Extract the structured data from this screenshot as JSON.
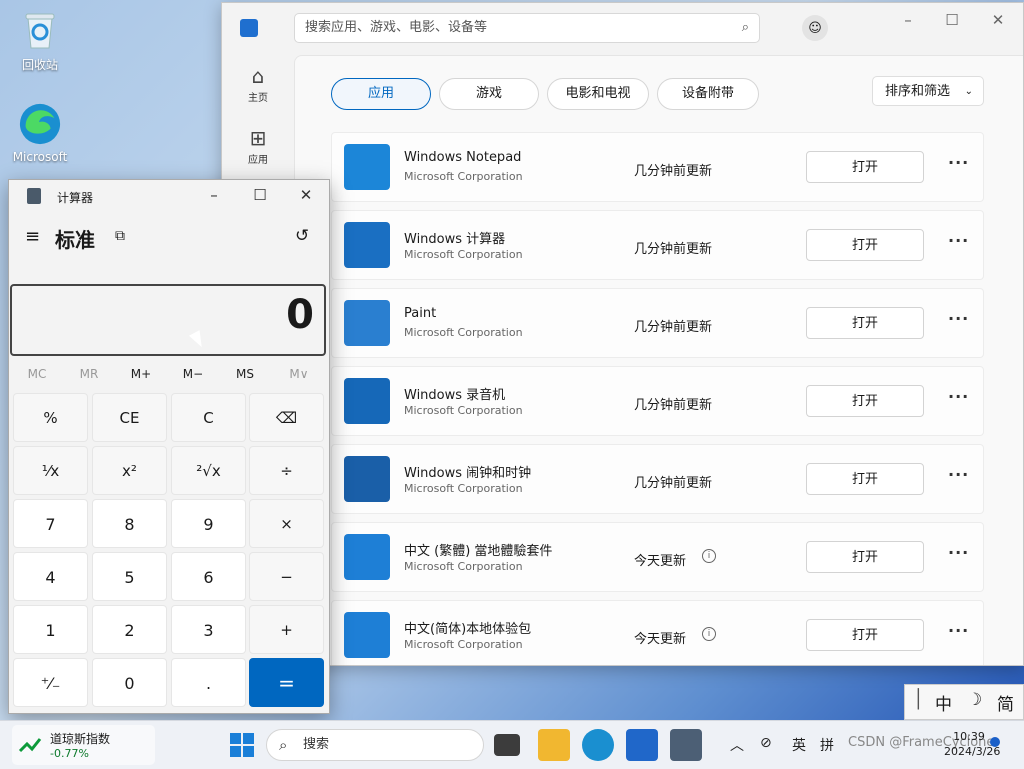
{
  "desktop": {
    "icons": [
      {
        "label": "回收站",
        "icon": "recycle-bin-icon"
      },
      {
        "label": "Microsoft Edge",
        "icon": "edge-icon"
      }
    ]
  },
  "store": {
    "search_placeholder": "搜索应用、游戏、电影、设备等",
    "nav": [
      {
        "label": "主页",
        "icon": "home-icon"
      },
      {
        "label": "应用",
        "icon": "apps-icon"
      }
    ],
    "tabs": [
      "应用",
      "游戏",
      "电影和电视",
      "设备附带"
    ],
    "active_tab": "应用",
    "sort_label": "排序和筛选",
    "open_label": "打开",
    "rows": [
      {
        "name": "Windows Notepad",
        "publisher": "Microsoft Corporation",
        "status": "几分钟前更新",
        "icon": "notepad-icon",
        "color": "#1c86d8"
      },
      {
        "name": "Windows 计算器",
        "publisher": "Microsoft Corporation",
        "status": "几分钟前更新",
        "icon": "calculator-icon",
        "color": "#1a6fc2"
      },
      {
        "name": "Paint",
        "publisher": "Microsoft Corporation",
        "status": "几分钟前更新",
        "icon": "paint-icon",
        "color": "#2a7fd0"
      },
      {
        "name": "Windows 录音机",
        "publisher": "Microsoft Corporation",
        "status": "几分钟前更新",
        "icon": "recorder-icon",
        "color": "#1668b8"
      },
      {
        "name": "Windows 闹钟和时钟",
        "publisher": "Microsoft Corporation",
        "status": "几分钟前更新",
        "icon": "clock-icon",
        "color": "#1a5fa8"
      },
      {
        "name": "中文 (繁體) 當地體驗套件",
        "publisher": "Microsoft Corporation",
        "status": "今天更新",
        "icon": "language-pack-icon",
        "color": "#1e7fd6"
      },
      {
        "name": "中文(简体)本地体验包",
        "publisher": "Microsoft Corporation",
        "status": "今天更新",
        "icon": "language-pack-icon",
        "color": "#1e7fd6"
      }
    ]
  },
  "calculator": {
    "title": "计算器",
    "mode": "标准",
    "display": "0",
    "memory": [
      "MC",
      "MR",
      "M+",
      "M−",
      "MS",
      "M∨"
    ],
    "keys": [
      [
        "%",
        "CE",
        "C",
        "⌫"
      ],
      [
        "¹⁄x",
        "x²",
        "²√x",
        "÷"
      ],
      [
        "7",
        "8",
        "9",
        "×"
      ],
      [
        "4",
        "5",
        "6",
        "−"
      ],
      [
        "1",
        "2",
        "3",
        "+"
      ],
      [
        "⁺⁄₋",
        "0",
        ".",
        "="
      ]
    ]
  },
  "ime": {
    "items": [
      "中",
      "☽",
      "简"
    ]
  },
  "taskbar": {
    "widget_label": "道琼斯指数",
    "widget_value": "-0.77%",
    "search_label": "搜索",
    "tray_lang": "英",
    "tray_ime": "拼",
    "time": "10:39",
    "date": "2024/3/26",
    "watermark": "CSDN @FrameCyclone"
  }
}
